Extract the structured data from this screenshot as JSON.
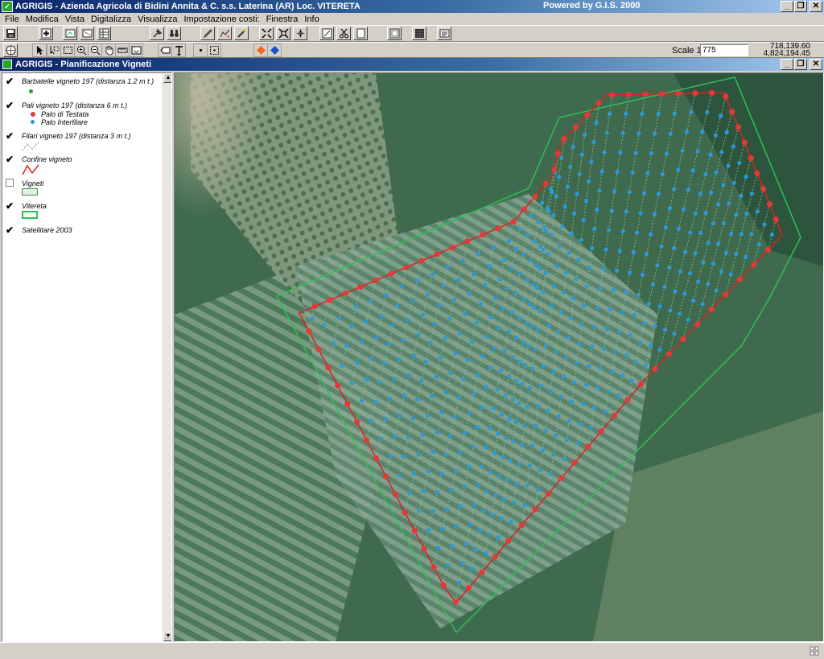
{
  "window": {
    "title": "AGRIGIS - Azienda Agricola di Bidini Annita & C. s.s. Laterina (AR) Loc. VITERETA",
    "powered": "Powered by G.I.S. 2000"
  },
  "menu": [
    "File",
    "Modifica",
    "Vista",
    "Digitalizza",
    "Visualizza",
    "Impostazione costi:",
    "Finestra",
    "Info"
  ],
  "scale": {
    "label": "Scale 1:",
    "value": "775"
  },
  "coords": {
    "x": "718,139.60",
    "y": "4,824,194.45"
  },
  "child_window": {
    "title": "AGRIGIS - Pianificazione Vigneti"
  },
  "legend": {
    "items": [
      {
        "label": "Barbatelle vigneto 197 (distanza 1.2 m t.)",
        "checked": true
      },
      {
        "label": "Pali vigneto 197 (distanza 6 m t.)",
        "checked": true
      },
      {
        "label": "Filari vigneto 197 (distanza 3 m t.)",
        "checked": true
      },
      {
        "label": "Confine vigneto",
        "checked": true
      },
      {
        "label": "Vigneti",
        "checked": false
      },
      {
        "label": "Vitereta",
        "checked": true
      },
      {
        "label": "Satellitare 2003",
        "checked": true
      }
    ],
    "pali_sub": [
      "Palo di Testata",
      "Palo Interfilare"
    ]
  },
  "colors": {
    "titlebar": "#0a246a",
    "barbatelle": "#2fa22f",
    "palo_testata": "#e03a3a",
    "palo_interfilare": "#2a9ad8",
    "filari": "#8abf8a",
    "confine": "#e02020",
    "vitereta": "#2fbf5a"
  }
}
